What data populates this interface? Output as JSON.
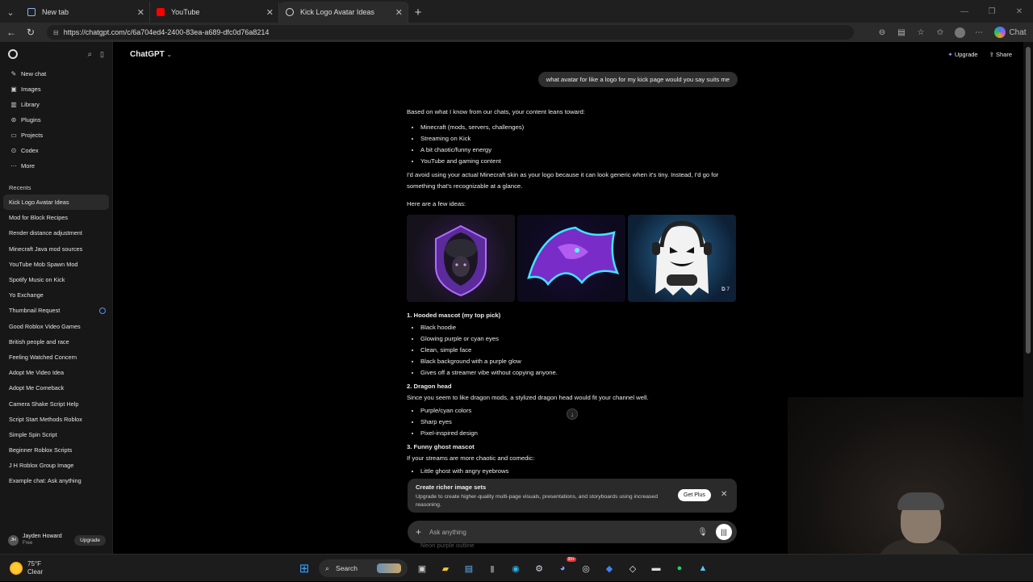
{
  "browser": {
    "tabs": [
      {
        "label": "New tab",
        "color": "#8ab4f8"
      },
      {
        "label": "YouTube",
        "color": "#ff0000"
      },
      {
        "label": "Kick Logo Avatar Ideas",
        "color": "#dddddd"
      }
    ],
    "url": "https://chatgpt.com/c/6a704ed4-2400-83ea-a689-dfc0d76a8214",
    "copilot_label": "Chat"
  },
  "sidebar": {
    "nav": [
      {
        "label": "New chat",
        "icon": "edit-icon"
      },
      {
        "label": "Images",
        "icon": "image-icon"
      },
      {
        "label": "Library",
        "icon": "library-icon"
      },
      {
        "label": "Plugins",
        "icon": "plugin-icon"
      },
      {
        "label": "Projects",
        "icon": "folder-icon"
      },
      {
        "label": "Codex",
        "icon": "codex-icon"
      },
      {
        "label": "More",
        "icon": "more-icon"
      }
    ],
    "recents_heading": "Recents",
    "recents": [
      "Kick Logo Avatar Ideas",
      "Mod for Block Recipes",
      "Render distance adjustment",
      "Minecraft Java mod sources",
      "YouTube Mob Spawn Mod",
      "Spotify Music on Kick",
      "Yo Exchange",
      "Thumbnail Request",
      "Good Roblox Video Games",
      "British people and race",
      "Feeling Watched Concern",
      "Adopt Me Video Idea",
      "Adopt Me Comeback",
      "Camera Shake Script Help",
      "Script Start Methods Roblox",
      "Simple Spin Script",
      "Beginner Roblox Scripts",
      "J H Roblox Group Image",
      "Example chat: Ask anything"
    ],
    "user": {
      "initials": "JH",
      "name": "Jayden Howard",
      "plan": "Free",
      "upgrade": "Upgrade"
    }
  },
  "header": {
    "model": "ChatGPT",
    "upgrade": "Upgrade",
    "share": "Share"
  },
  "chat": {
    "user_message": "what avatar for like a logo for my kick page would you say suits me",
    "intro": "Based on what I know from our chats, your content leans toward:",
    "traits": [
      "Minecraft (mods, servers, challenges)",
      "Streaming on Kick",
      "A bit chaotic/funny energy",
      "YouTube and gaming content"
    ],
    "advice": "I'd avoid using your actual Minecraft skin as your logo because it can look generic when it's tiny. Instead, I'd go for something that's recognizable at a glance.",
    "ideas_intro": "Here are a few ideas:",
    "image_count": "7",
    "idea1_title": "1. Hooded mascot (my top pick)",
    "idea1_points": [
      "Black hoodie",
      "Glowing purple or cyan eyes",
      "Clean, simple face",
      "Black background with a purple glow",
      "Gives off a streamer vibe without copying anyone."
    ],
    "idea2_title": "2. Dragon head",
    "idea2_desc": "Since you seem to like dragon mods, a stylized dragon head would fit your channel well.",
    "idea2_points": [
      "Purple/cyan colors",
      "Sharp eyes",
      "Pixel-inspired design"
    ],
    "idea3_title": "3. Funny ghost mascot",
    "idea3_desc": "If your streams are more chaotic and comedic:",
    "idea3_first_point": "Little ghost with angry eyebrows",
    "behind_text": "Neon purple outline"
  },
  "upsell": {
    "title": "Create richer image sets",
    "desc": "Upgrade to create higher-quality multi-page visuals, presentations, and storyboards using increased reasoning.",
    "button": "Get Plus"
  },
  "composer": {
    "placeholder": "Ask anything"
  },
  "taskbar": {
    "temp": "75°F",
    "condition": "Clear",
    "search": "Search",
    "badge": "99+"
  }
}
